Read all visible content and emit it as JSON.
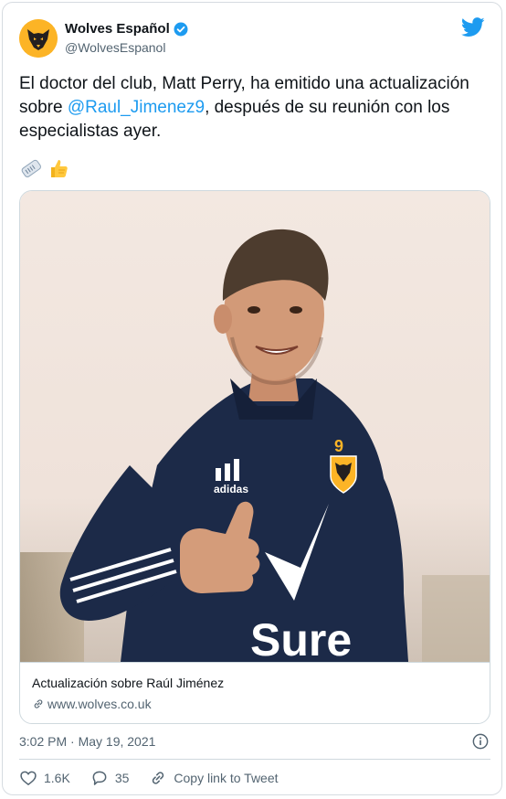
{
  "tweet": {
    "display_name": "Wolves Español",
    "handle": "@WolvesEspanol",
    "text_before": "El doctor del club, Matt Perry, ha emitido una actualización sobre ",
    "mention": "@Raul_Jimenez9",
    "text_after": ", después de su reunión con los especialistas ayer.",
    "emojis": [
      "newspaper-icon",
      "thumbs-up-icon"
    ],
    "timestamp": "3:02 PM · May 19, 2021"
  },
  "card": {
    "title": "Actualización sobre Raúl Jiménez",
    "domain": "www.wolves.co.uk",
    "jersey_number": "9",
    "sponsor": "Sure",
    "kit_brand": "adidas"
  },
  "actions": {
    "likes": "1.6K",
    "replies": "35",
    "copy_link": "Copy link to Tweet"
  },
  "colors": {
    "accent": "#1d9bf0",
    "wolves_gold": "#fcb426",
    "kit_navy": "#1c2a48"
  }
}
